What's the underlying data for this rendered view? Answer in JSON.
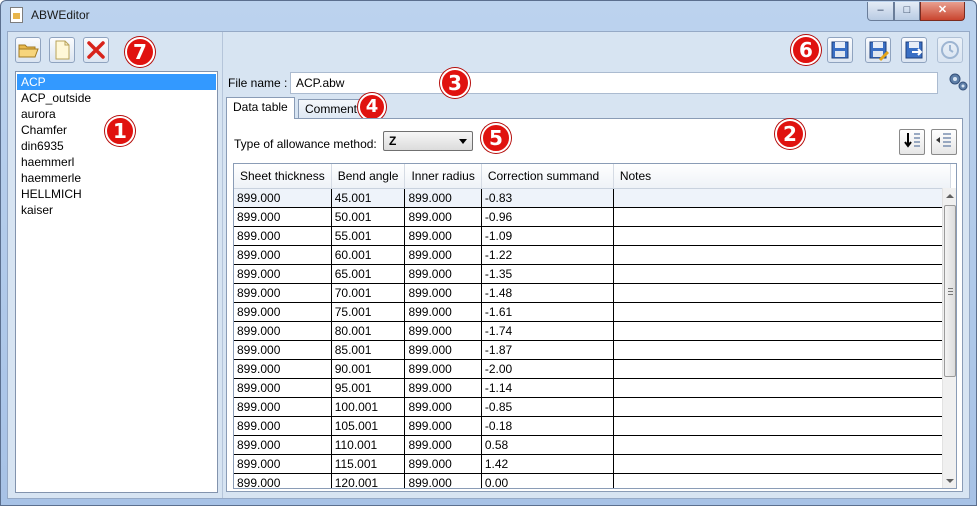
{
  "window": {
    "title": "ABWEditor",
    "minimize_glyph": "–",
    "maximize_glyph": "□",
    "close_glyph": "✕"
  },
  "sidebar": {
    "items": [
      "ACP",
      "ACP_outside",
      "aurora",
      "Chamfer",
      "din6935",
      "haemmerl",
      "haemmerle",
      "HELLMICH",
      "kaiser"
    ],
    "selected_index": 0
  },
  "toolbar_left": {
    "icons": [
      "open-folder-icon",
      "new-file-icon",
      "delete-x-icon"
    ]
  },
  "toolbar_right": {
    "icons": [
      "save-icon",
      "save-as-icon",
      "export-icon",
      "history-icon"
    ]
  },
  "file": {
    "label": "File name :",
    "value": "ACP.abw"
  },
  "tabs": [
    {
      "label": "Data table",
      "active": true
    },
    {
      "label": "Comment",
      "active": false
    }
  ],
  "allowance": {
    "label": "Type of allowance method:",
    "selected": "Z"
  },
  "table": {
    "headers": [
      "Sheet thickness",
      "Bend angle",
      "Inner radius",
      "Correction summand",
      "Notes"
    ],
    "rows": [
      [
        "899.000",
        "45.001",
        "899.000",
        "-0.83",
        ""
      ],
      [
        "899.000",
        "50.001",
        "899.000",
        "-0.96",
        ""
      ],
      [
        "899.000",
        "55.001",
        "899.000",
        "-1.09",
        ""
      ],
      [
        "899.000",
        "60.001",
        "899.000",
        "-1.22",
        ""
      ],
      [
        "899.000",
        "65.001",
        "899.000",
        "-1.35",
        ""
      ],
      [
        "899.000",
        "70.001",
        "899.000",
        "-1.48",
        ""
      ],
      [
        "899.000",
        "75.001",
        "899.000",
        "-1.61",
        ""
      ],
      [
        "899.000",
        "80.001",
        "899.000",
        "-1.74",
        ""
      ],
      [
        "899.000",
        "85.001",
        "899.000",
        "-1.87",
        ""
      ],
      [
        "899.000",
        "90.001",
        "899.000",
        "-2.00",
        ""
      ],
      [
        "899.000",
        "95.001",
        "899.000",
        "-1.14",
        ""
      ],
      [
        "899.000",
        "100.001",
        "899.000",
        "-0.85",
        ""
      ],
      [
        "899.000",
        "105.001",
        "899.000",
        "-0.18",
        ""
      ],
      [
        "899.000",
        "110.001",
        "899.000",
        "0.58",
        ""
      ],
      [
        "899.000",
        "115.001",
        "899.000",
        "1.42",
        ""
      ],
      [
        "899.000",
        "120.001",
        "899.000",
        "0.00",
        ""
      ]
    ]
  },
  "badges": [
    "1",
    "2",
    "3",
    "4",
    "5",
    "6",
    "7"
  ],
  "colors": {
    "badge": "#e0120f",
    "selection": "#3399ff"
  }
}
